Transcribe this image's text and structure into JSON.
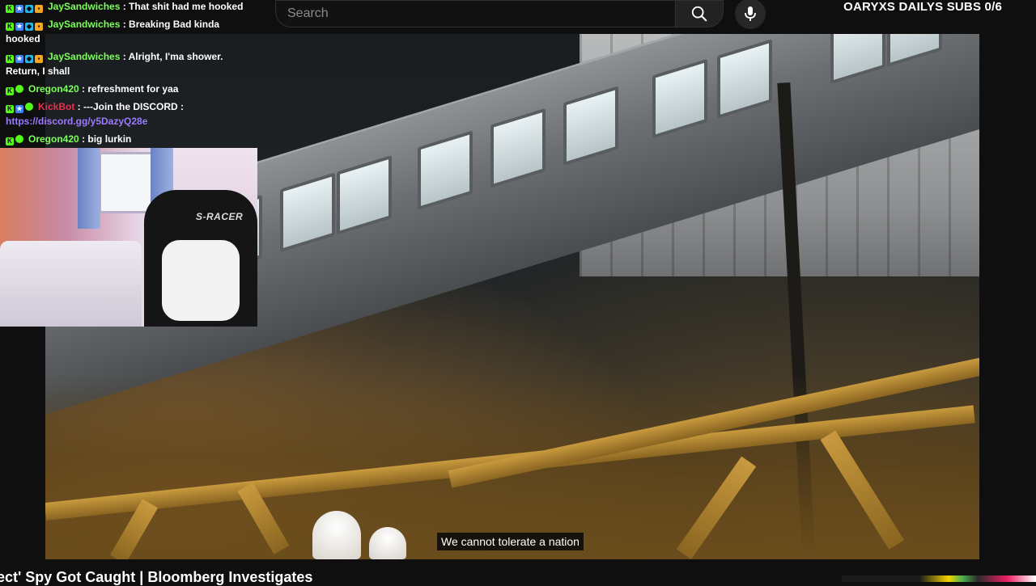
{
  "header": {
    "search_placeholder": "Search",
    "sub_goal": "OARYXS DAILYS SUBS 0/6"
  },
  "chat": {
    "messages": [
      {
        "user": "JaySandwiches",
        "user_color": "#7cff5b",
        "text": " : That shit had me hooked"
      },
      {
        "user": "JaySandwiches",
        "user_color": "#7cff5b",
        "text": " : Breaking Bad kinda hooked"
      },
      {
        "user": "JaySandwiches",
        "user_color": "#7cff5b",
        "text": " : Alright, I'ma shower. Return, I shall"
      },
      {
        "user": "Oregon420",
        "user_color": "#7cff5b",
        "text": " : refreshment for yaa"
      },
      {
        "user": "KickBot",
        "user_color": "#e5304b",
        "text": " : ---Join the DISCORD :",
        "link": "https://discord.gg/y5DazyQ28e"
      },
      {
        "user": "Oregon420",
        "user_color": "#7cff5b",
        "text": " : big lurkin"
      }
    ]
  },
  "webcam": {
    "chair_brand": "S-RACER"
  },
  "video": {
    "subtitle": "We cannot tolerate a nation",
    "title": "ect' Spy Got Caught | Bloomberg Investigates"
  },
  "icons": {
    "search": "search-icon",
    "mic": "microphone-icon"
  }
}
